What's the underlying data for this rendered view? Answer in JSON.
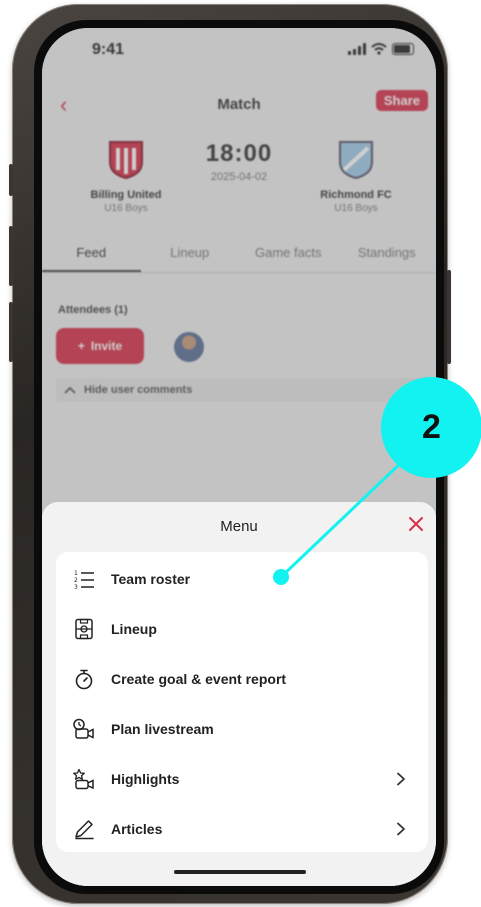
{
  "status_bar": {
    "time": "9:41"
  },
  "nav": {
    "back_glyph": "‹",
    "title": "Match",
    "share_label": "Share"
  },
  "match": {
    "home": {
      "name": "Billing United",
      "group": "U16 Boys"
    },
    "away": {
      "name": "Richmond FC",
      "group": "U16 Boys"
    },
    "kickoff": "18:00",
    "date": "2025-04-02"
  },
  "tabs": [
    {
      "label": "Feed",
      "active": true
    },
    {
      "label": "Lineup",
      "active": false
    },
    {
      "label": "Game facts",
      "active": false
    },
    {
      "label": "Standings",
      "active": false
    }
  ],
  "feed": {
    "attendees_label": "Attendees (1)",
    "invite_label": "Invite",
    "invite_glyph": "+",
    "hide_comments_label": "Hide user comments"
  },
  "menu": {
    "title": "Menu",
    "items": [
      {
        "label": "Team roster",
        "icon": "numbered-list-icon",
        "has_chevron": false
      },
      {
        "label": "Lineup",
        "icon": "pitch-icon",
        "has_chevron": false
      },
      {
        "label": "Create goal & event report",
        "icon": "stopwatch-icon",
        "has_chevron": false
      },
      {
        "label": "Plan livestream",
        "icon": "livestream-camera-icon",
        "has_chevron": false
      },
      {
        "label": "Highlights",
        "icon": "star-camera-icon",
        "has_chevron": true
      },
      {
        "label": "Articles",
        "icon": "pencil-icon",
        "has_chevron": true
      }
    ]
  },
  "callout": {
    "number": "2"
  },
  "colors": {
    "accent": "#d6314a",
    "callout": "#12f3f1",
    "dark": "#222222"
  }
}
